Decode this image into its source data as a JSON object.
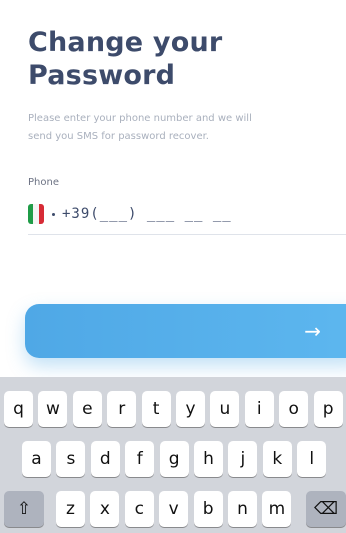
{
  "header": {
    "title_line1": "Change your",
    "title_line2": "Password",
    "description_line1": "Please enter your phone number and we will",
    "description_line2": "send you SMS for password recover."
  },
  "phone": {
    "label": "Phone",
    "country_flag": "italy-flag",
    "value": "+39(___) ___ __ __"
  },
  "submit": {
    "icon": "right-arrow-icon",
    "glyph": "→"
  },
  "keyboard": {
    "row1": [
      "q",
      "w",
      "e",
      "r",
      "t",
      "y",
      "u",
      "i",
      "o",
      "p"
    ],
    "row2": [
      "a",
      "s",
      "d",
      "f",
      "g",
      "h",
      "j",
      "k",
      "l"
    ],
    "row3": [
      "z",
      "x",
      "c",
      "v",
      "b",
      "n",
      "m"
    ],
    "shift_glyph": "⇧",
    "delete_glyph": "⌫"
  }
}
